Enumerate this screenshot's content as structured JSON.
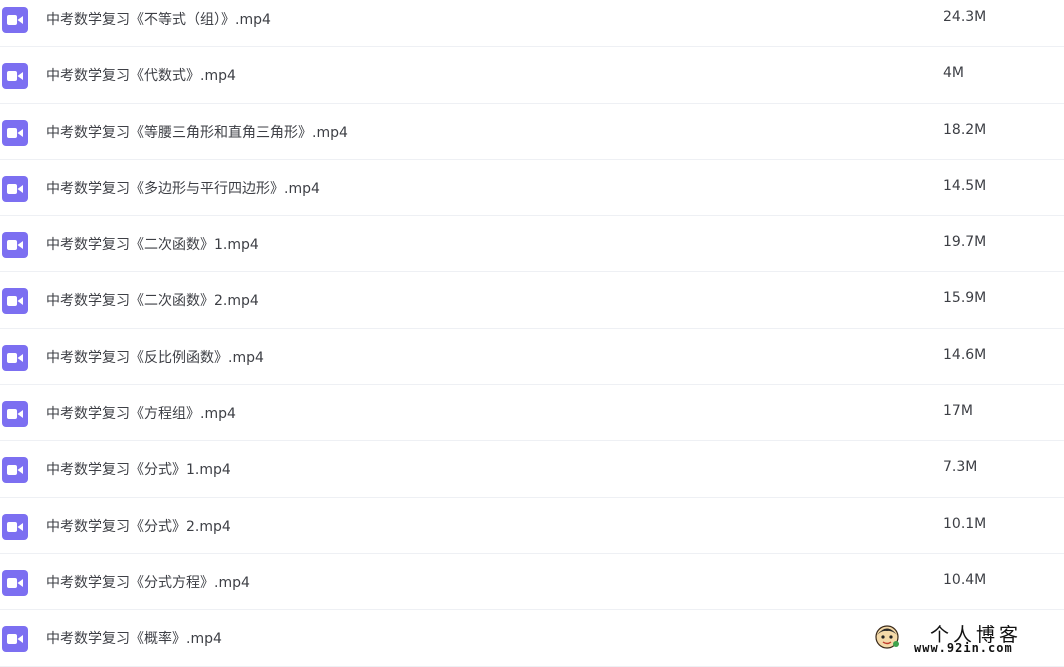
{
  "file_list": {
    "icon": "video-file-icon",
    "icon_color": "#7c6ff1",
    "files": [
      {
        "name": "中考数学复习《不等式（组）》.mp4",
        "size": "24.3M"
      },
      {
        "name": "中考数学复习《代数式》.mp4",
        "size": "4M"
      },
      {
        "name": "中考数学复习《等腰三角形和直角三角形》.mp4",
        "size": "18.2M"
      },
      {
        "name": "中考数学复习《多边形与平行四边形》.mp4",
        "size": "14.5M"
      },
      {
        "name": "中考数学复习《二次函数》1.mp4",
        "size": "19.7M"
      },
      {
        "name": "中考数学复习《二次函数》2.mp4",
        "size": "15.9M"
      },
      {
        "name": "中考数学复习《反比例函数》.mp4",
        "size": "14.6M"
      },
      {
        "name": "中考数学复习《方程组》.mp4",
        "size": "17M"
      },
      {
        "name": "中考数学复习《分式》1.mp4",
        "size": "7.3M"
      },
      {
        "name": "中考数学复习《分式》2.mp4",
        "size": "10.1M"
      },
      {
        "name": "中考数学复习《分式方程》.mp4",
        "size": "10.4M"
      },
      {
        "name": "中考数学复习《概率》.mp4",
        "size": ""
      }
    ]
  },
  "watermark": {
    "title": "个人博客",
    "url": "www.92in.com",
    "logo_icon": "blog-mascot-icon"
  }
}
